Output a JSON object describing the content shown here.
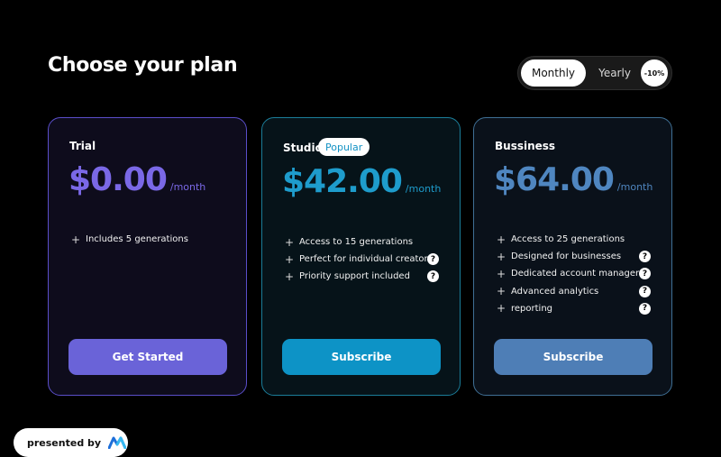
{
  "page": {
    "title": "Choose your plan"
  },
  "billing": {
    "monthly_label": "Monthly",
    "yearly_label": "Yearly",
    "discount": "-10%"
  },
  "plans": [
    {
      "name": "Trial",
      "price": "$0.00",
      "period": "/month",
      "features": [
        {
          "text": "Includes 5 generations",
          "help": false
        }
      ],
      "cta": "Get Started",
      "accent": "#6a63d8"
    },
    {
      "name": "Studio",
      "badge": "Popular",
      "price": "$42.00",
      "period": "/month",
      "features": [
        {
          "text": "Access to 15 generations",
          "help": false
        },
        {
          "text": "Perfect for individual creators",
          "help": true
        },
        {
          "text": "Priority support included",
          "help": true
        }
      ],
      "cta": "Subscribe",
      "accent": "#0d93c6"
    },
    {
      "name": "Bussiness",
      "price": "$64.00",
      "period": "/month",
      "features": [
        {
          "text": "Access to 25 generations",
          "help": false
        },
        {
          "text": "Designed for businesses",
          "help": true
        },
        {
          "text": "Dedicated account manager",
          "help": true
        },
        {
          "text": "Advanced analytics",
          "help": true
        },
        {
          "text": "reporting",
          "help": true
        }
      ],
      "cta": "Subscribe",
      "accent": "#4e7eb6"
    }
  ],
  "icons": {
    "plus": "+",
    "help": "?"
  },
  "footer": {
    "presented_by": "presented by"
  }
}
